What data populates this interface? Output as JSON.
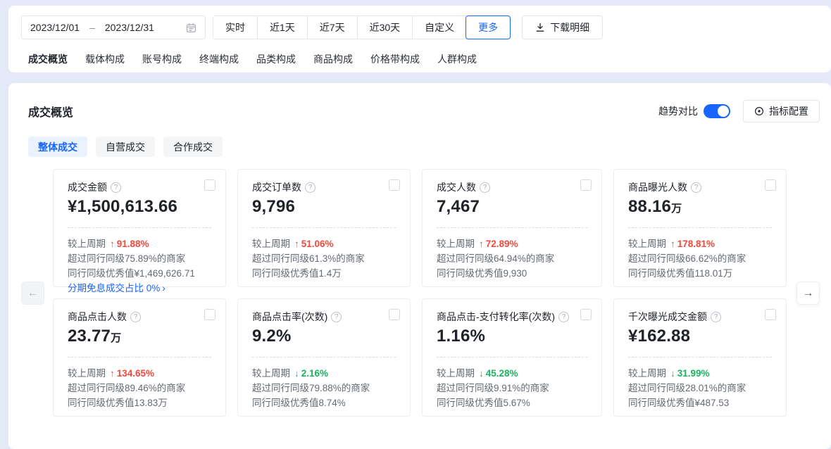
{
  "icons": {
    "help": "?",
    "chevron_right": "›",
    "arrow_left": "←",
    "arrow_right": "→"
  },
  "colors": {
    "accent_blue": "#1966ff",
    "up_red": "#f5483b",
    "down_green": "#17b35e",
    "page_bg": "#e4e9f8"
  },
  "toolbar": {
    "date_start": "2023/12/01",
    "date_separator": "–",
    "date_end": "2023/12/31",
    "quick_ranges": [
      {
        "label": "实时",
        "active": "false"
      },
      {
        "label": "近1天",
        "active": "false"
      },
      {
        "label": "近7天",
        "active": "false"
      },
      {
        "label": "近30天",
        "active": "false"
      },
      {
        "label": "自定义",
        "active": "false"
      },
      {
        "label": "更多",
        "active": "true"
      }
    ],
    "download_label": "下载明细"
  },
  "nav": {
    "tabs": [
      {
        "label": "成交概览",
        "active": "true"
      },
      {
        "label": "载体构成",
        "active": "false"
      },
      {
        "label": "账号构成",
        "active": "false"
      },
      {
        "label": "终端构成",
        "active": "false"
      },
      {
        "label": "品类构成",
        "active": "false"
      },
      {
        "label": "商品构成",
        "active": "false"
      },
      {
        "label": "价格带构成",
        "active": "false"
      },
      {
        "label": "人群构成",
        "active": "false"
      }
    ]
  },
  "panel": {
    "title": "成交概览",
    "trend_toggle_label": "趋势对比",
    "trend_toggle_on": "true",
    "metric_config_label": "指标配置",
    "sub_tabs": [
      {
        "label": "整体成交",
        "active": "true"
      },
      {
        "label": "自营成交",
        "active": "false"
      },
      {
        "label": "合作成交",
        "active": "false"
      }
    ]
  },
  "cards": [
    {
      "title": "成交金额",
      "value": "¥1,500,613.66",
      "suffix": "",
      "delta_label": "较上周期",
      "trend": "up",
      "delta_arrow": "↑",
      "delta": "91.88%",
      "peer_line": "超过同行同级75.89%的商家",
      "excellent_line": "同行同级优秀值¥1,469,626.71",
      "extra_link": "分期免息成交占比 0%"
    },
    {
      "title": "成交订单数",
      "value": "9,796",
      "suffix": "",
      "delta_label": "较上周期",
      "trend": "up",
      "delta_arrow": "↑",
      "delta": "51.06%",
      "peer_line": "超过同行同级61.3%的商家",
      "excellent_line": "同行同级优秀值1.4万"
    },
    {
      "title": "成交人数",
      "value": "7,467",
      "suffix": "",
      "delta_label": "较上周期",
      "trend": "up",
      "delta_arrow": "↑",
      "delta": "72.89%",
      "peer_line": "超过同行同级64.94%的商家",
      "excellent_line": "同行同级优秀值9,930"
    },
    {
      "title": "商品曝光人数",
      "value": "88.16",
      "suffix": "万",
      "delta_label": "较上周期",
      "trend": "up",
      "delta_arrow": "↑",
      "delta": "178.81%",
      "peer_line": "超过同行同级66.62%的商家",
      "excellent_line": "同行同级优秀值118.01万"
    },
    {
      "title": "商品点击人数",
      "value": "23.77",
      "suffix": "万",
      "delta_label": "较上周期",
      "trend": "up",
      "delta_arrow": "↑",
      "delta": "134.65%",
      "peer_line": "超过同行同级89.46%的商家",
      "excellent_line": "同行同级优秀值13.83万"
    },
    {
      "title": "商品点击率(次数)",
      "value": "9.2%",
      "suffix": "",
      "delta_label": "较上周期",
      "trend": "down",
      "delta_arrow": "↓",
      "delta": "2.16%",
      "peer_line": "超过同行同级79.88%的商家",
      "excellent_line": "同行同级优秀值8.74%"
    },
    {
      "title": "商品点击-支付转化率(次数)",
      "value": "1.16%",
      "suffix": "",
      "delta_label": "较上周期",
      "trend": "down",
      "delta_arrow": "↓",
      "delta": "45.28%",
      "peer_line": "超过同行同级9.91%的商家",
      "excellent_line": "同行同级优秀值5.67%"
    },
    {
      "title": "千次曝光成交金额",
      "value": "¥162.88",
      "suffix": "",
      "delta_label": "较上周期",
      "trend": "down",
      "delta_arrow": "↓",
      "delta": "31.99%",
      "peer_line": "超过同行同级28.01%的商家",
      "excellent_line": "同行同级优秀值¥487.53"
    }
  ]
}
